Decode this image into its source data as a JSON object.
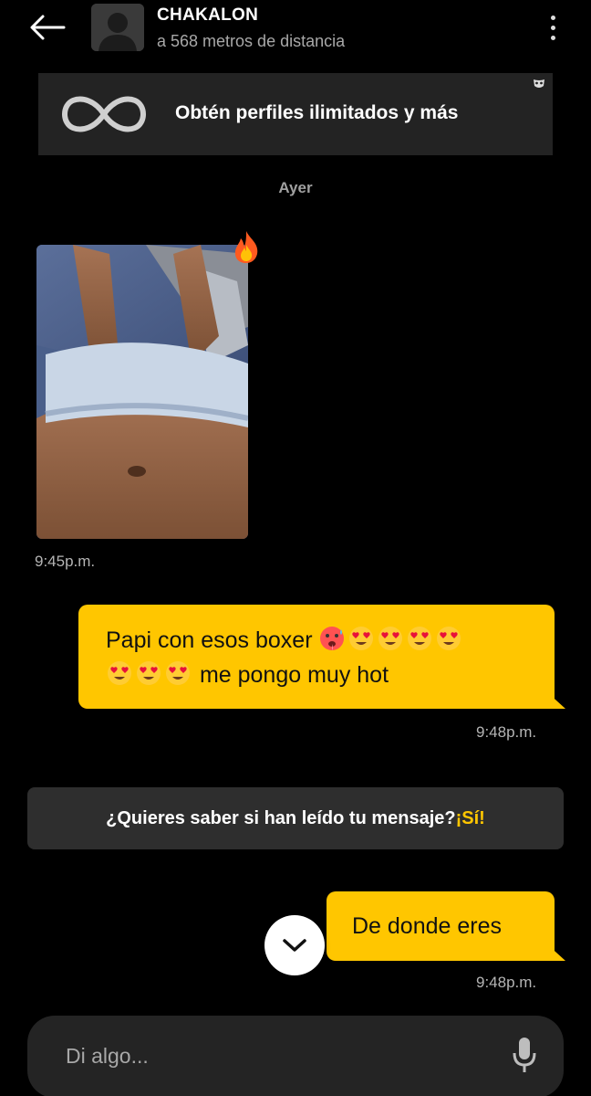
{
  "header": {
    "title": "CHAKALON",
    "subtitle": "a 568 metros de distancia"
  },
  "promo": {
    "text": "Obtén perfiles ilimitados y más",
    "icon": "infinity-icon"
  },
  "conversation": {
    "day_separator": "Ayer",
    "messages": [
      {
        "type": "photo",
        "direction": "incoming",
        "reaction": "fire-emoji",
        "time": "9:45p.m."
      },
      {
        "type": "text",
        "direction": "outgoing",
        "line1": "Papi con esos boxer",
        "line2": "me pongo muy hot",
        "emojis_line1": [
          "hot-face",
          "heart-eyes",
          "heart-eyes",
          "heart-eyes",
          "heart-eyes"
        ],
        "emojis_line2": [
          "heart-eyes",
          "heart-eyes",
          "heart-eyes"
        ],
        "time": "9:48p.m."
      },
      {
        "type": "text",
        "direction": "outgoing",
        "text": "De donde eres",
        "time": "9:48p.m."
      }
    ]
  },
  "read_receipts": {
    "question": "¿Quieres saber si han leído tu mensaje?",
    "cta": "¡Sí!"
  },
  "composer": {
    "placeholder": "Di algo..."
  },
  "colors": {
    "accent": "#ffc600",
    "background": "#000000",
    "surface": "#232323"
  }
}
